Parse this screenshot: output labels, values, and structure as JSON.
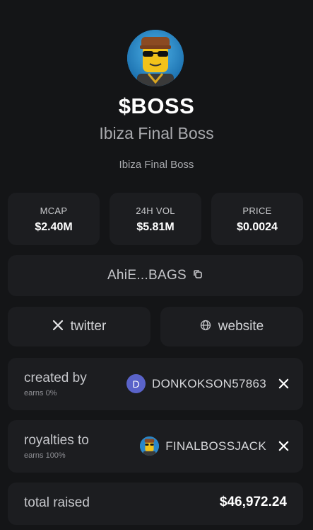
{
  "token": {
    "ticker": "$BOSS",
    "name": "Ibiza Final Boss",
    "description": "Ibiza Final Boss"
  },
  "stats": [
    {
      "label": "MCAP",
      "value": "$2.40M"
    },
    {
      "label": "24H VOL",
      "value": "$5.81M"
    },
    {
      "label": "PRICE",
      "value": "$0.0024"
    }
  ],
  "contract": {
    "display": "AhiE...BAGS",
    "icon": "copy-icon"
  },
  "links": {
    "twitter": {
      "label": "twitter",
      "icon": "x-logo-icon"
    },
    "website": {
      "label": "website",
      "icon": "globe-icon"
    }
  },
  "creator": {
    "title": "created by",
    "earns": "earns 0%",
    "avatar_letter": "D",
    "avatar_color": "#5a63c9",
    "username": "DONKOKSON57863"
  },
  "royalties": {
    "title": "royalties to",
    "earns": "earns 100%",
    "username": "FINALBOSSJACK"
  },
  "raised": {
    "title": "total raised",
    "value": "$46,972.24"
  },
  "colors": {
    "background": "#141517",
    "card": "#1c1d20",
    "text_primary": "#ffffff",
    "text_secondary": "#a9aaae"
  }
}
